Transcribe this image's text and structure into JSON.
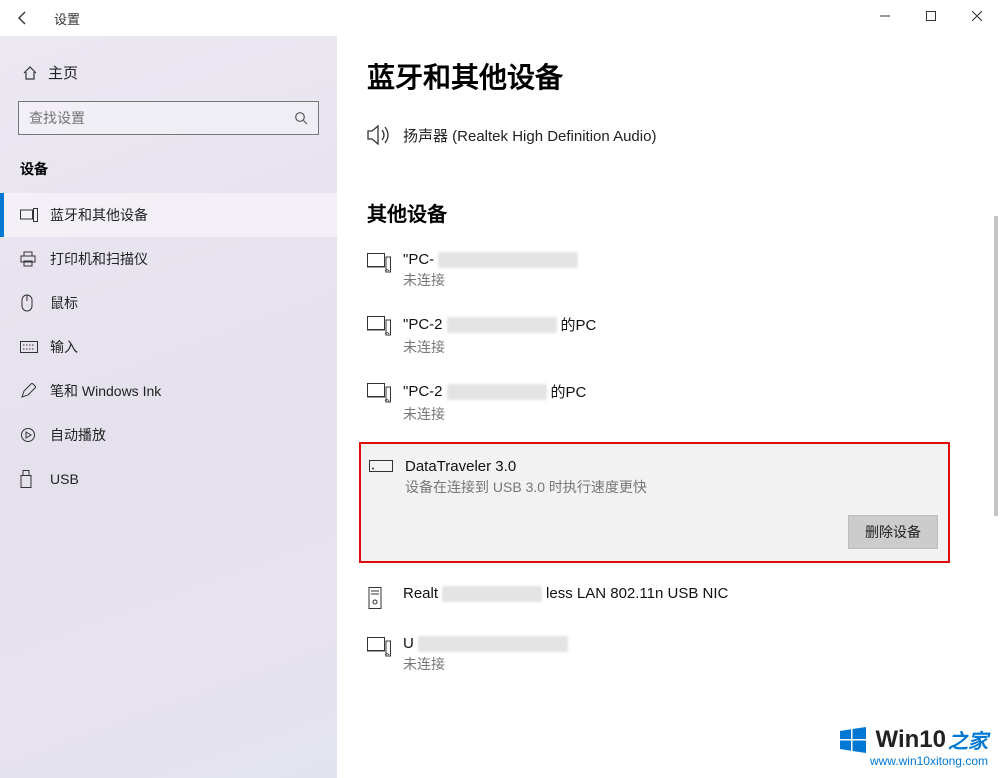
{
  "titlebar": {
    "title": "设置"
  },
  "sidebar": {
    "home": "主页",
    "search_placeholder": "查找设置",
    "section": "设备",
    "items": [
      {
        "label": "蓝牙和其他设备"
      },
      {
        "label": "打印机和扫描仪"
      },
      {
        "label": "鼠标"
      },
      {
        "label": "输入"
      },
      {
        "label": "笔和 Windows Ink"
      },
      {
        "label": "自动播放"
      },
      {
        "label": "USB"
      }
    ]
  },
  "main": {
    "heading": "蓝牙和其他设备",
    "audio_label": "扬声器 (Realtek High Definition Audio)",
    "other_heading": "其他设备",
    "devices": [
      {
        "prefix": "\"PC-",
        "suffix": "",
        "status": "未连接",
        "icon": "pc"
      },
      {
        "prefix": "\"PC-2",
        "suffix": "的PC",
        "status": "未连接",
        "icon": "pc"
      },
      {
        "prefix": "\"PC-2",
        "suffix": "的PC",
        "status": "未连接",
        "icon": "pc"
      }
    ],
    "selected": {
      "name": "DataTraveler 3.0",
      "desc": "设备在连接到 USB 3.0 时执行速度更快",
      "remove": "删除设备"
    },
    "after": [
      {
        "prefix": "Realt",
        "suffix": "less LAN 802.11n USB NIC",
        "icon": "tower"
      },
      {
        "prefix": "U",
        "suffix": "",
        "status": "未连接",
        "icon": "pc"
      }
    ]
  },
  "watermark": {
    "brand": "Win10",
    "suffix": "之家",
    "url": "www.win10xitong.com"
  }
}
